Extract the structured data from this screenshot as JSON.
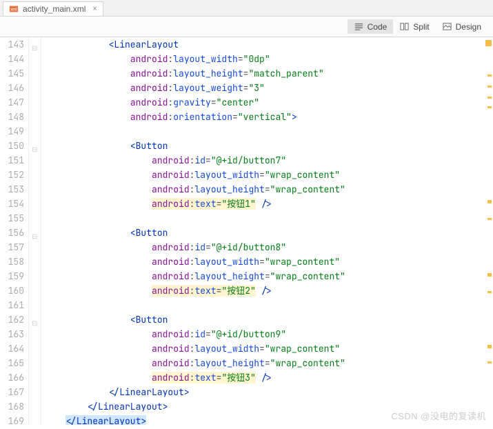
{
  "tab": {
    "filename": "activity_main.xml"
  },
  "toolbar": {
    "code": "Code",
    "split": "Split",
    "design": "Design"
  },
  "lines": {
    "start": 143,
    "end": 169,
    "l143": {
      "tag": "LinearLayout"
    },
    "l144": {
      "ns": "android",
      "attr": "layout_width",
      "val": "0dp"
    },
    "l145": {
      "ns": "android",
      "attr": "layout_height",
      "val": "match_parent"
    },
    "l146": {
      "ns": "android",
      "attr": "layout_weight",
      "val": "3"
    },
    "l147": {
      "ns": "android",
      "attr": "gravity",
      "val": "center"
    },
    "l148": {
      "ns": "android",
      "attr": "orientation",
      "val": "vertical"
    },
    "l150": {
      "tag": "Button"
    },
    "l151": {
      "ns": "android",
      "attr": "id",
      "val": "@+id/button7"
    },
    "l152": {
      "ns": "android",
      "attr": "layout_width",
      "val": "wrap_content"
    },
    "l153": {
      "ns": "android",
      "attr": "layout_height",
      "val": "wrap_content"
    },
    "l154": {
      "ns": "android",
      "attr": "text",
      "val": "按钮1"
    },
    "l156": {
      "tag": "Button"
    },
    "l157": {
      "ns": "android",
      "attr": "id",
      "val": "@+id/button8"
    },
    "l158": {
      "ns": "android",
      "attr": "layout_width",
      "val": "wrap_content"
    },
    "l159": {
      "ns": "android",
      "attr": "layout_height",
      "val": "wrap_content"
    },
    "l160": {
      "ns": "android",
      "attr": "text",
      "val": "按钮2"
    },
    "l162": {
      "tag": "Button"
    },
    "l163": {
      "ns": "android",
      "attr": "id",
      "val": "@+id/button9"
    },
    "l164": {
      "ns": "android",
      "attr": "layout_width",
      "val": "wrap_content"
    },
    "l165": {
      "ns": "android",
      "attr": "layout_height",
      "val": "wrap_content"
    },
    "l166": {
      "ns": "android",
      "attr": "text",
      "val": "按钮3"
    },
    "l167": {
      "close": "LinearLayout"
    },
    "l168": {
      "close": "LinearLayout"
    },
    "l169": {
      "close": "LinearLayout",
      "caret": true
    }
  },
  "watermark": "CSDN @没电的复读机"
}
